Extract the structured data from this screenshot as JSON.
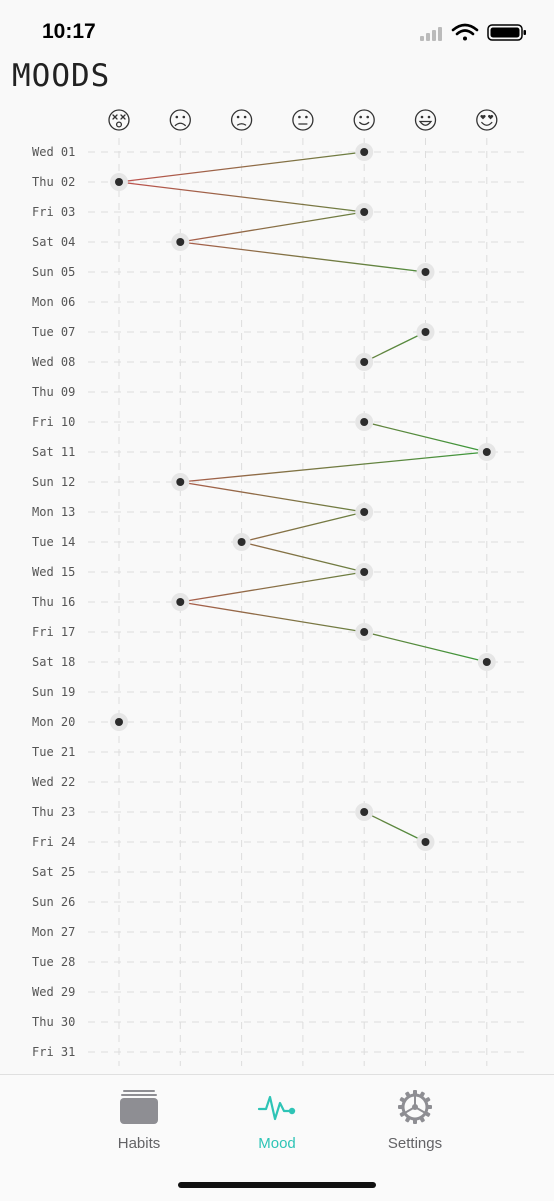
{
  "status_bar": {
    "time": "10:17"
  },
  "title": "MOODS",
  "colors": {
    "accent": "#2ec4b6",
    "inactive_tab": "#8e8e93",
    "dot": "#2b2b2b",
    "dot_halo": "#e6e6e6",
    "grid": "#dddddd",
    "line_negative": "#c0504d",
    "line_positive": "#3a9a3a"
  },
  "chart_data": {
    "type": "scatter",
    "mood_levels": [
      {
        "index": 0,
        "icon": "dizzy-face-icon"
      },
      {
        "index": 1,
        "icon": "frowning-face-icon"
      },
      {
        "index": 2,
        "icon": "worried-face-icon"
      },
      {
        "index": 3,
        "icon": "neutral-face-icon"
      },
      {
        "index": 4,
        "icon": "slightly-smiling-face-icon"
      },
      {
        "index": 5,
        "icon": "grinning-face-icon"
      },
      {
        "index": 6,
        "icon": "heart-eyes-face-icon"
      }
    ],
    "days": [
      {
        "label": "Wed 01",
        "mood": 4
      },
      {
        "label": "Thu 02",
        "mood": 0
      },
      {
        "label": "Fri 03",
        "mood": 4
      },
      {
        "label": "Sat 04",
        "mood": 1
      },
      {
        "label": "Sun 05",
        "mood": 5
      },
      {
        "label": "Mon 06",
        "mood": null
      },
      {
        "label": "Tue 07",
        "mood": 5
      },
      {
        "label": "Wed 08",
        "mood": 4
      },
      {
        "label": "Thu 09",
        "mood": null
      },
      {
        "label": "Fri 10",
        "mood": 4
      },
      {
        "label": "Sat 11",
        "mood": 6
      },
      {
        "label": "Sun 12",
        "mood": 1
      },
      {
        "label": "Mon 13",
        "mood": 4
      },
      {
        "label": "Tue 14",
        "mood": 2
      },
      {
        "label": "Wed 15",
        "mood": 4
      },
      {
        "label": "Thu 16",
        "mood": 1
      },
      {
        "label": "Fri 17",
        "mood": 4
      },
      {
        "label": "Sat 18",
        "mood": 6
      },
      {
        "label": "Sun 19",
        "mood": null
      },
      {
        "label": "Mon 20",
        "mood": 0
      },
      {
        "label": "Tue 21",
        "mood": null
      },
      {
        "label": "Wed 22",
        "mood": null
      },
      {
        "label": "Thu 23",
        "mood": 4
      },
      {
        "label": "Fri 24",
        "mood": 5
      },
      {
        "label": "Sat 25",
        "mood": null
      },
      {
        "label": "Sun 26",
        "mood": null
      },
      {
        "label": "Mon 27",
        "mood": null
      },
      {
        "label": "Tue 28",
        "mood": null
      },
      {
        "label": "Wed 29",
        "mood": null
      },
      {
        "label": "Thu 30",
        "mood": null
      },
      {
        "label": "Fri 31",
        "mood": null
      }
    ]
  },
  "tab_bar": {
    "tabs": [
      {
        "label": "Habits",
        "icon": "stacked-cards-icon",
        "active": false
      },
      {
        "label": "Mood",
        "icon": "heartbeat-icon",
        "active": true
      },
      {
        "label": "Settings",
        "icon": "gear-icon",
        "active": false
      }
    ]
  }
}
